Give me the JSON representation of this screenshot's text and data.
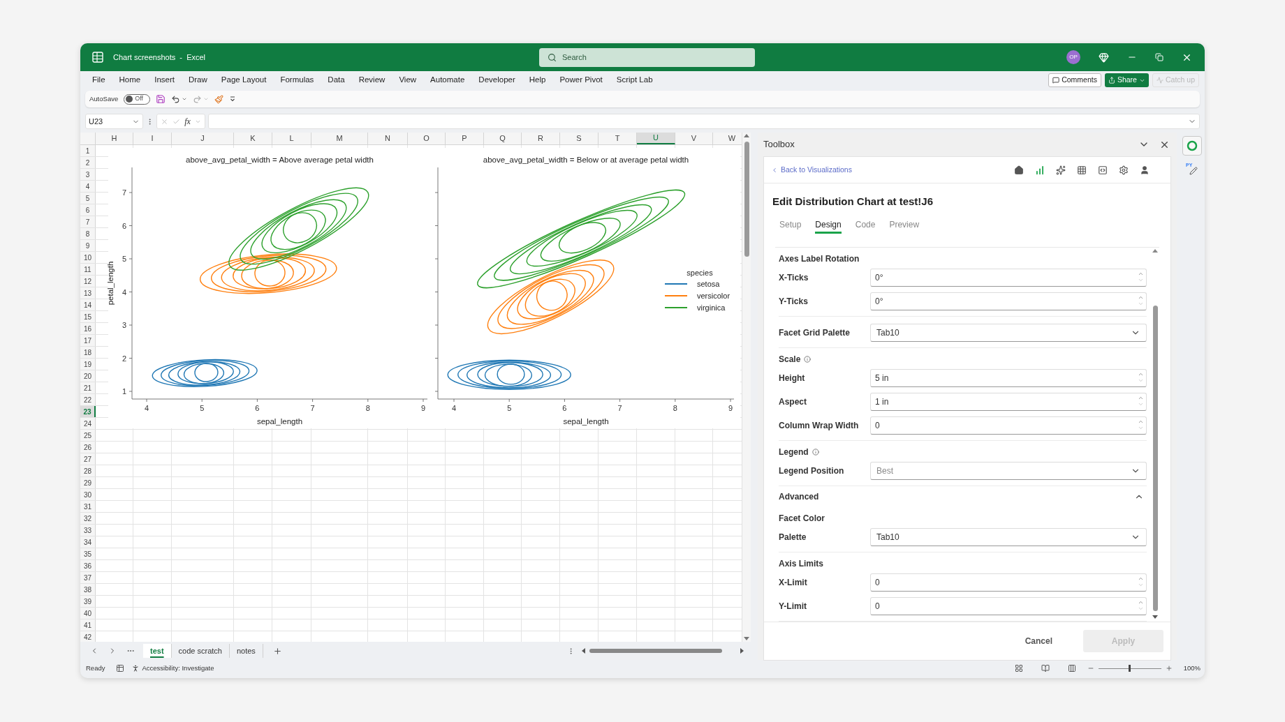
{
  "window": {
    "title": "Chart screenshots  -  Excel"
  },
  "search": {
    "placeholder": "Search"
  },
  "account": {
    "initials": "OP"
  },
  "menu": [
    {
      "label": "File"
    },
    {
      "label": "Home"
    },
    {
      "label": "Insert"
    },
    {
      "label": "Draw"
    },
    {
      "label": "Page Layout"
    },
    {
      "label": "Formulas"
    },
    {
      "label": "Data"
    },
    {
      "label": "Review"
    },
    {
      "label": "View"
    },
    {
      "label": "Automate"
    },
    {
      "label": "Developer"
    },
    {
      "label": "Help"
    },
    {
      "label": "Power Pivot"
    },
    {
      "label": "Script Lab"
    }
  ],
  "ribbon_buttons": [
    {
      "kind": "comments",
      "label": "Comments",
      "disabled": false
    },
    {
      "kind": "share",
      "label": "Share",
      "disabled": false
    },
    {
      "kind": "catch_up",
      "label": "Catch up",
      "disabled": true
    }
  ],
  "quick_access": {
    "autosave_label": "AutoSave",
    "autosave": {
      "label": "Off",
      "on": false
    }
  },
  "formula_bar": {
    "name_box": "U23",
    "function_label": "fx"
  },
  "sheet": {
    "columns": [
      {
        "label": "H",
        "selected": false
      },
      {
        "label": "I",
        "selected": false
      },
      {
        "label": "J",
        "selected": false
      },
      {
        "label": "K",
        "selected": false
      },
      {
        "label": "L",
        "selected": false
      },
      {
        "label": "M",
        "selected": false
      },
      {
        "label": "N",
        "selected": false
      },
      {
        "label": "O",
        "selected": false
      },
      {
        "label": "P",
        "selected": false
      },
      {
        "label": "Q",
        "selected": false
      },
      {
        "label": "R",
        "selected": false
      },
      {
        "label": "S",
        "selected": false
      },
      {
        "label": "T",
        "selected": false
      },
      {
        "label": "U",
        "selected": true
      },
      {
        "label": "V",
        "selected": false
      },
      {
        "label": "W",
        "selected": false
      }
    ],
    "rows": [
      {
        "label": "1",
        "selected": false
      },
      {
        "label": "2",
        "selected": false
      },
      {
        "label": "3",
        "selected": false
      },
      {
        "label": "4",
        "selected": false
      },
      {
        "label": "5",
        "selected": false
      },
      {
        "label": "6",
        "selected": false
      },
      {
        "label": "7",
        "selected": false
      },
      {
        "label": "8",
        "selected": false
      },
      {
        "label": "9",
        "selected": false
      },
      {
        "label": "10",
        "selected": false
      },
      {
        "label": "11",
        "selected": false
      },
      {
        "label": "12",
        "selected": false
      },
      {
        "label": "13",
        "selected": false
      },
      {
        "label": "14",
        "selected": false
      },
      {
        "label": "15",
        "selected": false
      },
      {
        "label": "16",
        "selected": false
      },
      {
        "label": "17",
        "selected": false
      },
      {
        "label": "18",
        "selected": false
      },
      {
        "label": "19",
        "selected": false
      },
      {
        "label": "20",
        "selected": false
      },
      {
        "label": "21",
        "selected": false
      },
      {
        "label": "22",
        "selected": false
      },
      {
        "label": "23",
        "selected": true
      },
      {
        "label": "24",
        "selected": false
      },
      {
        "label": "25",
        "selected": false
      },
      {
        "label": "26",
        "selected": false
      },
      {
        "label": "27",
        "selected": false
      },
      {
        "label": "28",
        "selected": false
      },
      {
        "label": "29",
        "selected": false
      },
      {
        "label": "30",
        "selected": false
      },
      {
        "label": "31",
        "selected": false
      },
      {
        "label": "32",
        "selected": false
      },
      {
        "label": "33",
        "selected": false
      },
      {
        "label": "34",
        "selected": false
      },
      {
        "label": "35",
        "selected": false
      },
      {
        "label": "36",
        "selected": false
      },
      {
        "label": "37",
        "selected": false
      },
      {
        "label": "38",
        "selected": false
      },
      {
        "label": "39",
        "selected": false
      },
      {
        "label": "40",
        "selected": false
      },
      {
        "label": "41",
        "selected": false
      },
      {
        "label": "42",
        "selected": false
      }
    ]
  },
  "facets": [
    {
      "title": "above_avg_petal_width = Above average petal width",
      "xticks": [
        "4",
        "5",
        "6",
        "7",
        "8",
        "9"
      ],
      "yticks": [
        "7",
        "6",
        "5",
        "4",
        "3",
        "2",
        "1"
      ],
      "xlabel": "sepal_length",
      "ylabel": "petal_length"
    },
    {
      "title": "above_avg_petal_width = Below or at average petal width",
      "xticks": [
        "4",
        "5",
        "6",
        "7",
        "8",
        "9"
      ],
      "xlabel": "sepal_length"
    }
  ],
  "legend": {
    "title": "species",
    "items": [
      {
        "label": "setosa",
        "color": "#1f77b4"
      },
      {
        "label": "versicolor",
        "color": "#ff7f0e"
      },
      {
        "label": "virginica",
        "color": "#2ca02c"
      }
    ]
  },
  "sheet_tabs": [
    {
      "label": "test",
      "selected": true
    },
    {
      "label": "code scratch",
      "selected": false
    },
    {
      "label": "notes",
      "selected": false
    }
  ],
  "status_bar": {
    "ready": "Ready",
    "accessibility": "Accessibility: Investigate",
    "zoom_slider": {
      "level": 0.5
    },
    "zoom": "100%"
  },
  "toolbox": {
    "title": "Toolbox",
    "back_link": "Back to Visualizations",
    "nav_icons": [
      {
        "kind": "home",
        "selected": false
      },
      {
        "kind": "chart",
        "selected": true
      },
      {
        "kind": "sparkle",
        "selected": false
      },
      {
        "kind": "grid",
        "selected": false
      },
      {
        "kind": "code",
        "selected": false
      },
      {
        "kind": "settings",
        "selected": false
      },
      {
        "kind": "user",
        "selected": false
      }
    ],
    "heading": "Edit Distribution Chart at test!J6",
    "tabs": [
      {
        "label": "Setup",
        "selected": false
      },
      {
        "label": "Design",
        "selected": true
      },
      {
        "label": "Code",
        "selected": false
      },
      {
        "label": "Preview",
        "selected": false
      }
    ],
    "sections": [
      {
        "kind": "section",
        "title": "Axes Label Rotation",
        "info": false,
        "fields": [
          {
            "kind": "number",
            "label": "X-Ticks",
            "value": "0°"
          },
          {
            "kind": "number",
            "label": "Y-Ticks",
            "value": "0°"
          }
        ]
      },
      {
        "kind": "section",
        "fields": [
          {
            "kind": "select",
            "label": "Facet Grid Palette",
            "value": "Tab10"
          }
        ]
      },
      {
        "kind": "section",
        "title": "Scale",
        "info": true,
        "fields": [
          {
            "kind": "number",
            "label": "Height",
            "value": "5 in"
          },
          {
            "kind": "number",
            "label": "Aspect",
            "value": "1 in"
          },
          {
            "kind": "number",
            "label": "Column Wrap Width",
            "value": "0"
          }
        ]
      },
      {
        "kind": "section",
        "title": "Legend",
        "info": true,
        "fields": [
          {
            "kind": "select",
            "label": "Legend Position",
            "placeholder": "Best"
          }
        ]
      },
      {
        "kind": "collapsible",
        "title": "Advanced",
        "expanded": true
      },
      {
        "kind": "section",
        "title": "Facet Color",
        "info": false,
        "fields": [
          {
            "kind": "select",
            "label": "Palette",
            "value": "Tab10"
          }
        ]
      },
      {
        "kind": "section",
        "title": "Axis Limits",
        "info": false,
        "fields": [
          {
            "kind": "number",
            "label": "X-Limit",
            "value": "0"
          },
          {
            "kind": "number",
            "label": "Y-Limit",
            "value": "0"
          }
        ]
      }
    ],
    "buttons": [
      {
        "label": "Cancel",
        "disabled": false
      },
      {
        "label": "Apply",
        "disabled": true
      }
    ]
  },
  "rail": [
    {
      "kind": "ring",
      "selected": true
    },
    {
      "kind": "py",
      "label": "PY",
      "selected": false
    }
  ]
}
